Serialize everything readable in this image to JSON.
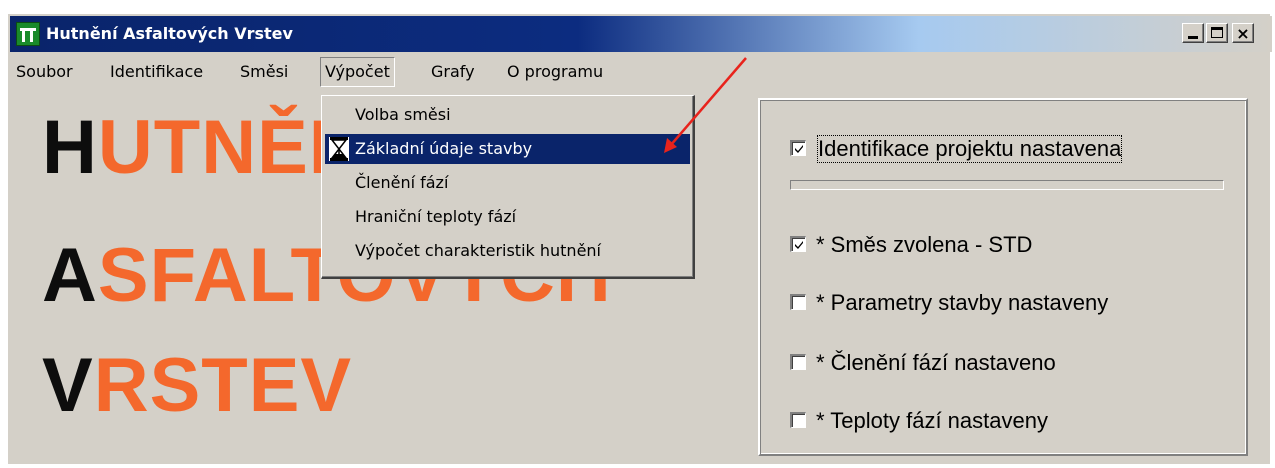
{
  "window": {
    "title": "Hutnění Asfaltových Vrstev",
    "controls": {
      "minimize": "_",
      "maximize": "□",
      "close": "×"
    }
  },
  "menubar": [
    {
      "label": "Soubor"
    },
    {
      "label": "Identifikace"
    },
    {
      "label": "Směsi"
    },
    {
      "label": "Výpočet",
      "open": true
    },
    {
      "label": "Grafy"
    },
    {
      "label": "O programu"
    }
  ],
  "splash": {
    "line1": {
      "first": "H",
      "rest": "UTNĚNÍ"
    },
    "line2": {
      "first": "A",
      "rest": "SFALTOVÝCH"
    },
    "line3": {
      "first": "V",
      "rest": "RSTEV"
    },
    "colors": {
      "first": "#0d0d0d",
      "rest": "#f4682c"
    }
  },
  "dropdown": {
    "items": [
      {
        "label": "Volba směsi",
        "selected": false
      },
      {
        "label": "Základní údaje stavby",
        "selected": true,
        "icon": "hourglass-icon"
      },
      {
        "label": "Členění fází",
        "selected": false
      },
      {
        "label": "Hraniční teploty fází",
        "selected": false
      },
      {
        "label": "Výpočet charakteristik hutnění",
        "selected": false
      }
    ]
  },
  "status_panel": {
    "items": [
      {
        "label": "Identifikace projektu nastavena",
        "checked": true,
        "focused": true
      },
      {
        "label": "* Směs zvolena - STD",
        "checked": true
      },
      {
        "label": "* Parametry stavby nastaveny",
        "checked": false
      },
      {
        "label": "* Členění fází nastaveno",
        "checked": false
      },
      {
        "label": "* Teploty fází nastaveny",
        "checked": false
      }
    ],
    "progress": 0
  },
  "colors": {
    "accent": "#0a246a",
    "face": "#d4d0c8",
    "arrow": "#e8231c"
  }
}
